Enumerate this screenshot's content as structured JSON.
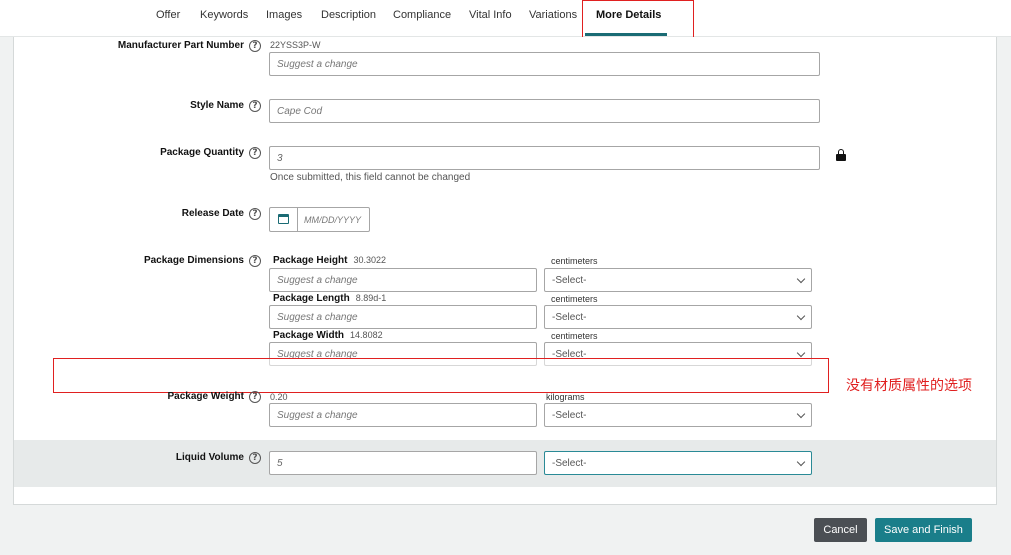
{
  "tabs": [
    "Offer",
    "Keywords",
    "Images",
    "Description",
    "Compliance",
    "Vital Info",
    "Variations",
    "More Details"
  ],
  "fields": {
    "manufacturer_part_number": {
      "label": "Manufacturer Part Number",
      "current": "22YSS3P-W",
      "placeholder": "Suggest a change"
    },
    "style_name": {
      "label": "Style Name",
      "placeholder": "Cape Cod"
    },
    "package_quantity": {
      "label": "Package Quantity",
      "value": "3",
      "hint": "Once submitted, this field cannot be changed"
    },
    "release_date": {
      "label": "Release Date",
      "placeholder": "MM/DD/YYYY"
    },
    "package_dimensions": {
      "label": "Package Dimensions",
      "rows": [
        {
          "name": "Package Height",
          "current": "30.3022",
          "placeholder": "Suggest a change",
          "unit_label": "centimeters",
          "unit_value": "-Select-"
        },
        {
          "name": "Package Length",
          "current": "8.89d-1",
          "placeholder": "Suggest a change",
          "unit_label": "centimeters",
          "unit_value": "-Select-"
        },
        {
          "name": "Package Width",
          "current": "14.8082",
          "placeholder": "Suggest a change",
          "unit_label": "centimeters",
          "unit_value": "-Select-"
        }
      ]
    },
    "package_weight": {
      "label": "Package Weight",
      "current": "0.20",
      "placeholder": "Suggest a change",
      "unit_label": "kilograms",
      "unit_value": "-Select-"
    },
    "liquid_volume": {
      "label": "Liquid Volume",
      "value": "5",
      "unit_value": "-Select-"
    }
  },
  "annotation": "没有材质属性的选项",
  "buttons": {
    "cancel": "Cancel",
    "save": "Save and Finish"
  },
  "colors": {
    "accent": "#1a7e8a",
    "annotation_red": "#e02020",
    "cancel_bg": "#4b4f54"
  }
}
